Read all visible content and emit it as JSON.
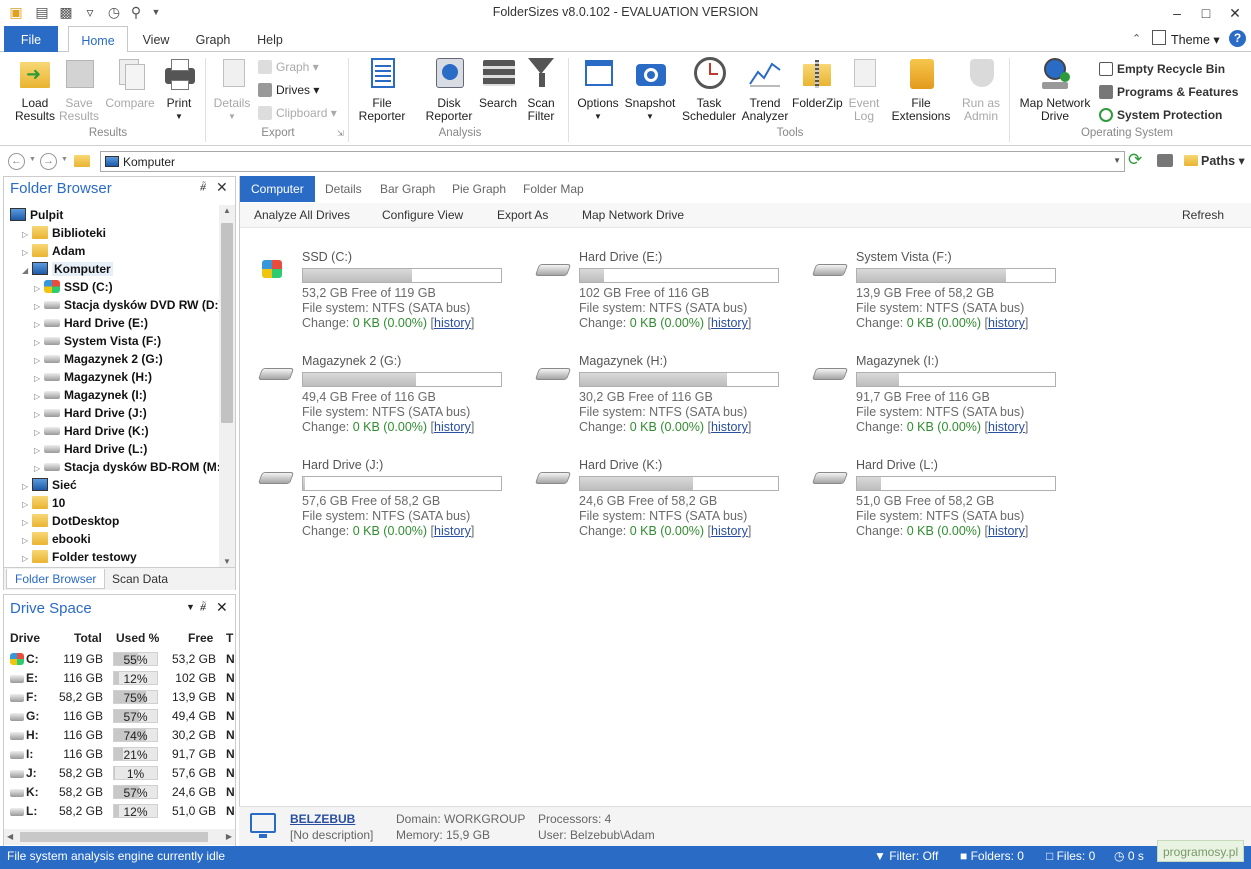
{
  "titlebar": {
    "title": "FolderSizes v8.0.102 - EVALUATION VERSION",
    "theme_label": "Theme"
  },
  "ribbon_tabs": [
    "File",
    "Home",
    "View",
    "Graph",
    "Help"
  ],
  "ribbon": {
    "results": {
      "load": "Load Results",
      "save": "Save Results",
      "compare": "Compare",
      "print": "Print",
      "group": "Results"
    },
    "export": {
      "details": "Details",
      "graph": "Graph",
      "drives": "Drives",
      "clipboard": "Clipboard",
      "group": "Export"
    },
    "analysis": {
      "file_reporter": "File Reporter",
      "disk_reporter": "Disk Reporter",
      "search": "Search",
      "scan_filter": "Scan Filter",
      "group": "Analysis"
    },
    "tools": {
      "options": "Options",
      "snapshot": "Snapshot",
      "task_scheduler": "Task Scheduler",
      "trend_analyzer": "Trend Analyzer",
      "folderzip": "FolderZip",
      "event_log": "Event Log",
      "file_extensions": "File Extensions",
      "run_as_admin": "Run as Admin",
      "group": "Tools"
    },
    "os": {
      "map_network_drive": "Map Network Drive",
      "empty_recycle_bin": "Empty Recycle Bin",
      "programs_features": "Programs & Features",
      "system_protection": "System Protection",
      "group": "Operating System"
    }
  },
  "address": {
    "path": "Komputer",
    "paths_label": "Paths"
  },
  "folder_browser": {
    "title": "Folder Browser",
    "items": [
      {
        "label": "Pulpit",
        "level": 0,
        "icon": "desktop"
      },
      {
        "label": "Biblioteki",
        "level": 1,
        "icon": "folder"
      },
      {
        "label": "Adam",
        "level": 1,
        "icon": "folder"
      },
      {
        "label": "Komputer",
        "level": 1,
        "icon": "computer"
      },
      {
        "label": "SSD (C:)",
        "level": 2,
        "icon": "windows"
      },
      {
        "label": "Stacja dysków DVD RW (D:)",
        "level": 2,
        "icon": "optical"
      },
      {
        "label": "Hard Drive (E:)",
        "level": 2,
        "icon": "drive"
      },
      {
        "label": "System Vista (F:)",
        "level": 2,
        "icon": "drive"
      },
      {
        "label": "Magazynek 2 (G:)",
        "level": 2,
        "icon": "drive"
      },
      {
        "label": "Magazynek (H:)",
        "level": 2,
        "icon": "drive"
      },
      {
        "label": "Magazynek (I:)",
        "level": 2,
        "icon": "drive"
      },
      {
        "label": "Hard Drive (J:)",
        "level": 2,
        "icon": "drive"
      },
      {
        "label": "Hard Drive (K:)",
        "level": 2,
        "icon": "drive"
      },
      {
        "label": "Hard Drive (L:)",
        "level": 2,
        "icon": "drive"
      },
      {
        "label": "Stacja dysków BD-ROM (M:)",
        "level": 2,
        "icon": "optical"
      },
      {
        "label": "Sieć",
        "level": 1,
        "icon": "network"
      },
      {
        "label": "10",
        "level": 1,
        "icon": "folder"
      },
      {
        "label": "DotDesktop",
        "level": 1,
        "icon": "folder"
      },
      {
        "label": "ebooki",
        "level": 1,
        "icon": "folder"
      },
      {
        "label": "Folder testowy",
        "level": 1,
        "icon": "folder"
      }
    ],
    "tabs": [
      "Folder Browser",
      "Scan Data"
    ]
  },
  "drive_space": {
    "title": "Drive Space",
    "columns": [
      "Drive",
      "Total",
      "Used %",
      "Free",
      "T"
    ],
    "rows": [
      {
        "drive": "C:",
        "total": "119 GB",
        "used": "55%",
        "used_pct": 55,
        "free": "53,2 GB",
        "t": "N"
      },
      {
        "drive": "E:",
        "total": "116 GB",
        "used": "12%",
        "used_pct": 12,
        "free": "102 GB",
        "t": "N"
      },
      {
        "drive": "F:",
        "total": "58,2 GB",
        "used": "75%",
        "used_pct": 75,
        "free": "13,9 GB",
        "t": "N"
      },
      {
        "drive": "G:",
        "total": "116 GB",
        "used": "57%",
        "used_pct": 57,
        "free": "49,4 GB",
        "t": "N"
      },
      {
        "drive": "H:",
        "total": "116 GB",
        "used": "74%",
        "used_pct": 74,
        "free": "30,2 GB",
        "t": "N"
      },
      {
        "drive": "I:",
        "total": "116 GB",
        "used": "21%",
        "used_pct": 21,
        "free": "91,7 GB",
        "t": "N"
      },
      {
        "drive": "J:",
        "total": "58,2 GB",
        "used": "1%",
        "used_pct": 1,
        "free": "57,6 GB",
        "t": "N"
      },
      {
        "drive": "K:",
        "total": "58,2 GB",
        "used": "57%",
        "used_pct": 57,
        "free": "24,6 GB",
        "t": "N"
      },
      {
        "drive": "L:",
        "total": "58,2 GB",
        "used": "12%",
        "used_pct": 12,
        "free": "51,0 GB",
        "t": "N"
      }
    ]
  },
  "main_tabs": [
    "Computer",
    "Details",
    "Bar Graph",
    "Pie Graph",
    "Folder Map"
  ],
  "toolbar": {
    "analyze_all": "Analyze All Drives",
    "configure_view": "Configure View",
    "export_as": "Export As",
    "map_network_drive": "Map Network Drive",
    "refresh": "Refresh"
  },
  "drives": [
    {
      "name": "SSD (C:)",
      "free": "53,2 GB Free of 119 GB",
      "fs": "File system: NTFS (SATA bus)",
      "change_prefix": "Change: ",
      "change": "0 KB (0.00%)",
      "history": "history",
      "used_pct": 55,
      "icon": "windows"
    },
    {
      "name": "Hard Drive (E:)",
      "free": "102 GB Free of 116 GB",
      "fs": "File system: NTFS (SATA bus)",
      "change_prefix": "Change: ",
      "change": "0 KB (0.00%)",
      "history": "history",
      "used_pct": 12,
      "icon": "hdd"
    },
    {
      "name": "System Vista (F:)",
      "free": "13,9 GB Free of 58,2 GB",
      "fs": "File system: NTFS (SATA bus)",
      "change_prefix": "Change: ",
      "change": "0 KB (0.00%)",
      "history": "history",
      "used_pct": 75,
      "icon": "hdd"
    },
    {
      "name": "Magazynek 2 (G:)",
      "free": "49,4 GB Free of 116 GB",
      "fs": "File system: NTFS (SATA bus)",
      "change_prefix": "Change: ",
      "change": "0 KB (0.00%)",
      "history": "history",
      "used_pct": 57,
      "icon": "hdd"
    },
    {
      "name": "Magazynek (H:)",
      "free": "30,2 GB Free of 116 GB",
      "fs": "File system: NTFS (SATA bus)",
      "change_prefix": "Change: ",
      "change": "0 KB (0.00%)",
      "history": "history",
      "used_pct": 74,
      "icon": "hdd"
    },
    {
      "name": "Magazynek (I:)",
      "free": "91,7 GB Free of 116 GB",
      "fs": "File system: NTFS (SATA bus)",
      "change_prefix": "Change: ",
      "change": "0 KB (0.00%)",
      "history": "history",
      "used_pct": 21,
      "icon": "hdd"
    },
    {
      "name": "Hard Drive (J:)",
      "free": "57,6 GB Free of 58,2 GB",
      "fs": "File system: NTFS (SATA bus)",
      "change_prefix": "Change: ",
      "change": "0 KB (0.00%)",
      "history": "history",
      "used_pct": 1,
      "icon": "hdd"
    },
    {
      "name": "Hard Drive (K:)",
      "free": "24,6 GB Free of 58,2 GB",
      "fs": "File system: NTFS (SATA bus)",
      "change_prefix": "Change: ",
      "change": "0 KB (0.00%)",
      "history": "history",
      "used_pct": 57,
      "icon": "hdd"
    },
    {
      "name": "Hard Drive (L:)",
      "free": "51,0 GB Free of 58,2 GB",
      "fs": "File system: NTFS (SATA bus)",
      "change_prefix": "Change: ",
      "change": "0 KB (0.00%)",
      "history": "history",
      "used_pct": 12,
      "icon": "hdd"
    }
  ],
  "computer_info": {
    "name": "BELZEBUB",
    "description": "[No description]",
    "domain": "Domain: WORKGROUP",
    "memory": "Memory: 15,9 GB",
    "processors": "Processors: 4",
    "user": "User: Belzebub\\Adam"
  },
  "status": {
    "text": "File system analysis engine currently idle",
    "filter": "Filter: Off",
    "folders": "Folders: 0",
    "files": "Files: 0",
    "time": "0 s",
    "watermark": "programosy.pl"
  },
  "colors": {
    "accent": "#2a6bc6",
    "green": "#2f8d2f"
  }
}
